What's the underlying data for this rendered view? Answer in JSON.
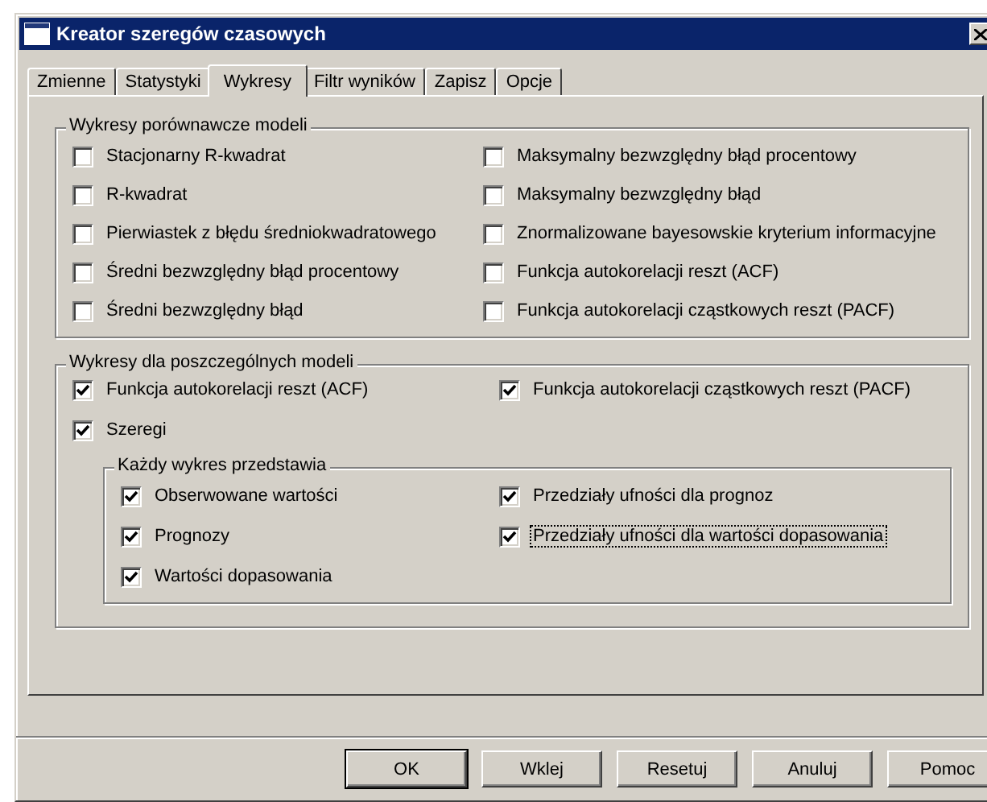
{
  "window": {
    "title": "Kreator szeregów czasowych"
  },
  "tabs": [
    {
      "label": "Zmienne",
      "selected": false
    },
    {
      "label": "Statystyki",
      "selected": false
    },
    {
      "label": "Wykresy",
      "selected": true
    },
    {
      "label": "Filtr wyników",
      "selected": false
    },
    {
      "label": "Zapisz",
      "selected": false
    },
    {
      "label": "Opcje",
      "selected": false
    }
  ],
  "comparison_group": {
    "title": "Wykresy porównawcze modeli",
    "items": [
      {
        "label": "Stacjonarny R-kwadrat",
        "checked": false
      },
      {
        "label": "Maksymalny bezwzględny błąd procentowy",
        "checked": false
      },
      {
        "label": "R-kwadrat",
        "checked": false
      },
      {
        "label": "Maksymalny bezwzględny błąd",
        "checked": false
      },
      {
        "label": "Pierwiastek z błędu średniokwadratowego",
        "checked": false
      },
      {
        "label": "Znormalizowane bayesowskie kryterium informacyjne",
        "checked": false
      },
      {
        "label": "Średni bezwzględny błąd procentowy",
        "checked": false
      },
      {
        "label": "Funkcja autokorelacji reszt (ACF)",
        "checked": false
      },
      {
        "label": "Średni bezwzględny błąd",
        "checked": false
      },
      {
        "label": "Funkcja autokorelacji cząstkowych reszt (PACF)",
        "checked": false
      }
    ]
  },
  "individual_group": {
    "title": "Wykresy dla poszczególnych modeli",
    "items": [
      {
        "label": "Funkcja autokorelacji reszt (ACF)",
        "checked": true
      },
      {
        "label": "Funkcja autokorelacji cząstkowych reszt (PACF)",
        "checked": true
      },
      {
        "label": "Szeregi",
        "checked": true
      }
    ],
    "sub_group": {
      "title": "Każdy wykres przedstawia",
      "items": [
        {
          "label": "Obserwowane wartości",
          "checked": true,
          "focused": false
        },
        {
          "label": "Przedziały ufności dla prognoz",
          "checked": true,
          "focused": false
        },
        {
          "label": "Prognozy",
          "checked": true,
          "focused": false
        },
        {
          "label": "Przedziały ufności dla wartości dopasowania",
          "checked": true,
          "focused": true
        },
        {
          "label": "Wartości dopasowania",
          "checked": true,
          "focused": false
        }
      ]
    }
  },
  "buttons": [
    {
      "label": "OK",
      "default": true
    },
    {
      "label": "Wklej",
      "default": false
    },
    {
      "label": "Resetuj",
      "default": false
    },
    {
      "label": "Anuluj",
      "default": false
    },
    {
      "label": "Pomoc",
      "default": false
    }
  ]
}
